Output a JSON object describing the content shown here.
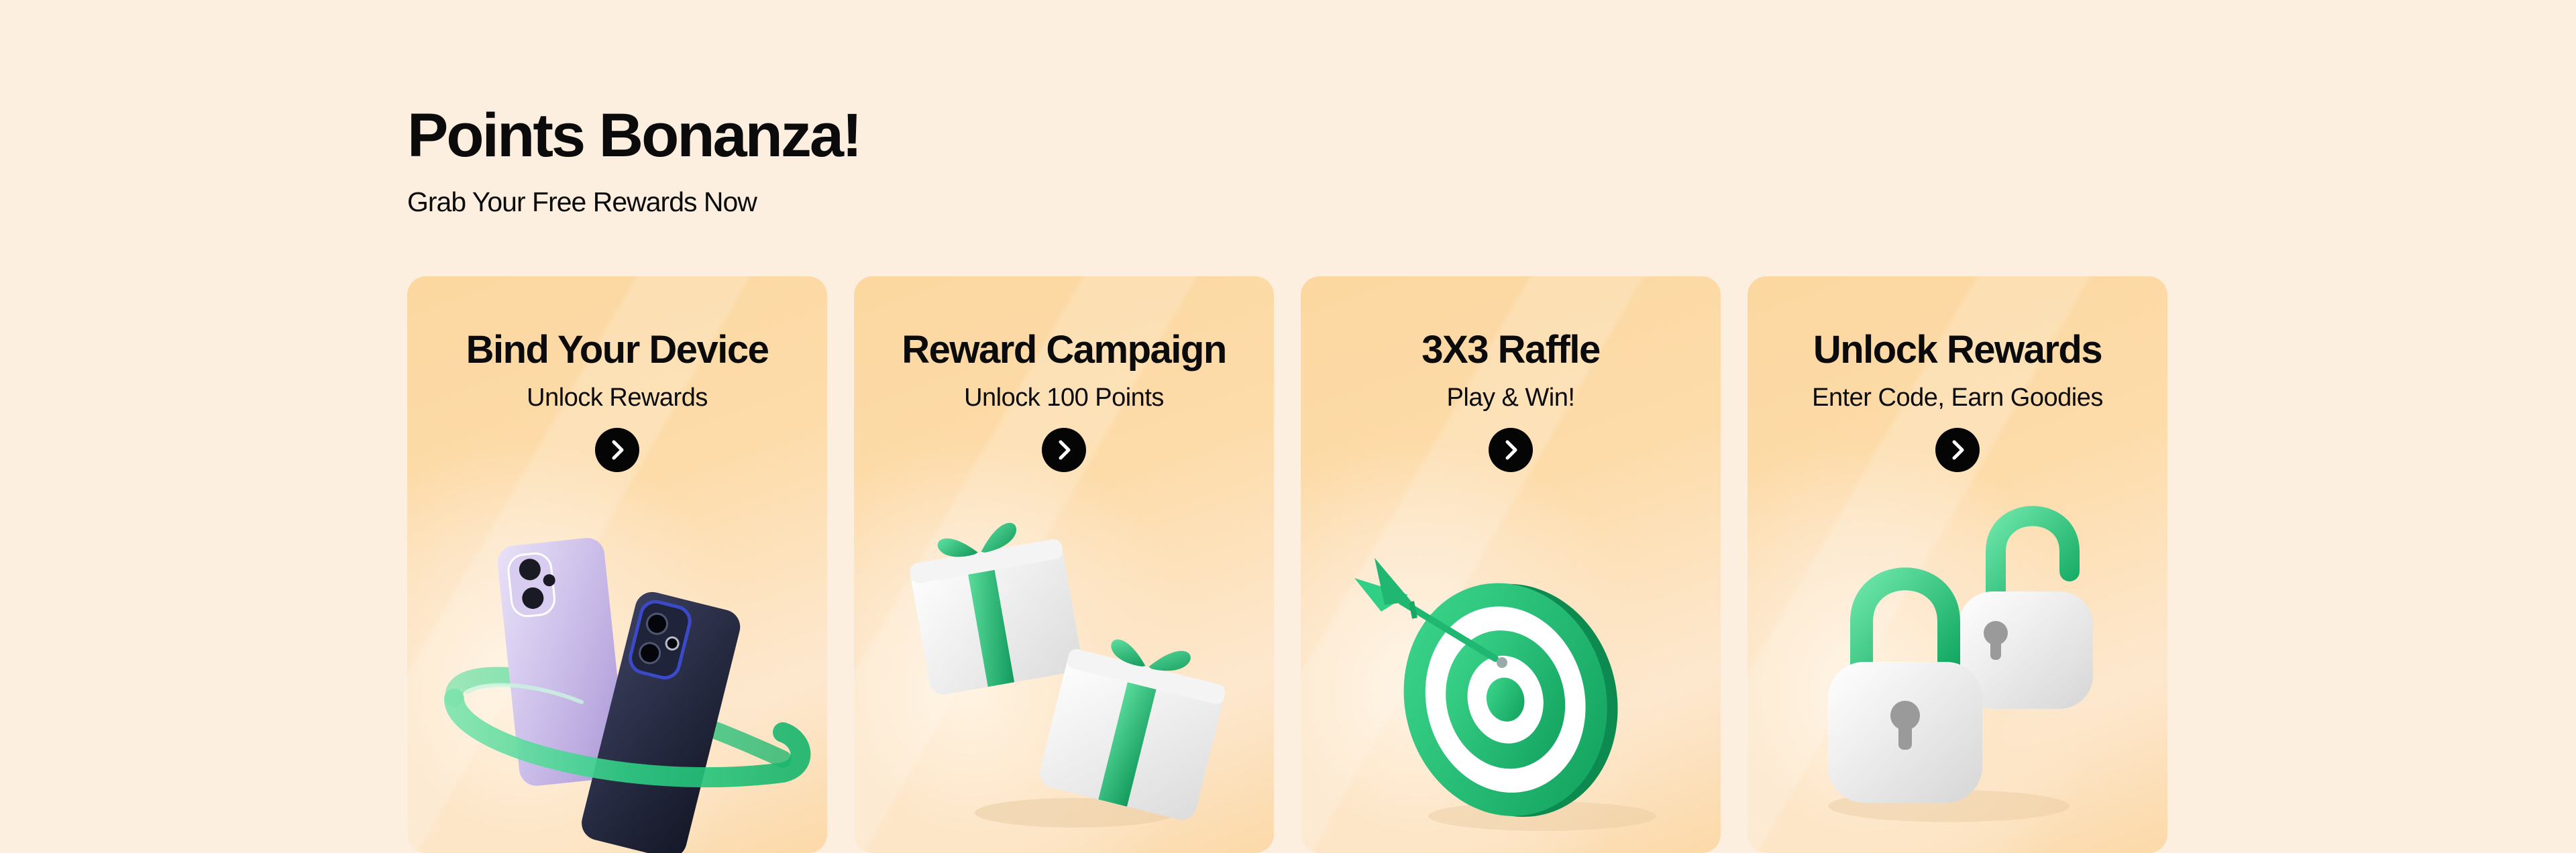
{
  "header": {
    "title": "Points Bonanza!",
    "subtitle": "Grab Your Free Rewards Now"
  },
  "cards": [
    {
      "title": "Bind Your Device",
      "subtitle": "Unlock Rewards",
      "icon": "phones-with-ring-illustration"
    },
    {
      "title": "Reward Campaign",
      "subtitle": "Unlock 100 Points",
      "icon": "gift-boxes-illustration"
    },
    {
      "title": "3X3 Raffle",
      "subtitle": "Play & Win!",
      "icon": "target-with-dart-illustration"
    },
    {
      "title": "Unlock Rewards",
      "subtitle": "Enter Code, Earn Goodies",
      "icon": "padlocks-illustration"
    }
  ],
  "colors": {
    "background": "#fdefdf",
    "card_gradient": "#fcd7a0",
    "accent_green": "#22c57a",
    "button": "#050505"
  }
}
